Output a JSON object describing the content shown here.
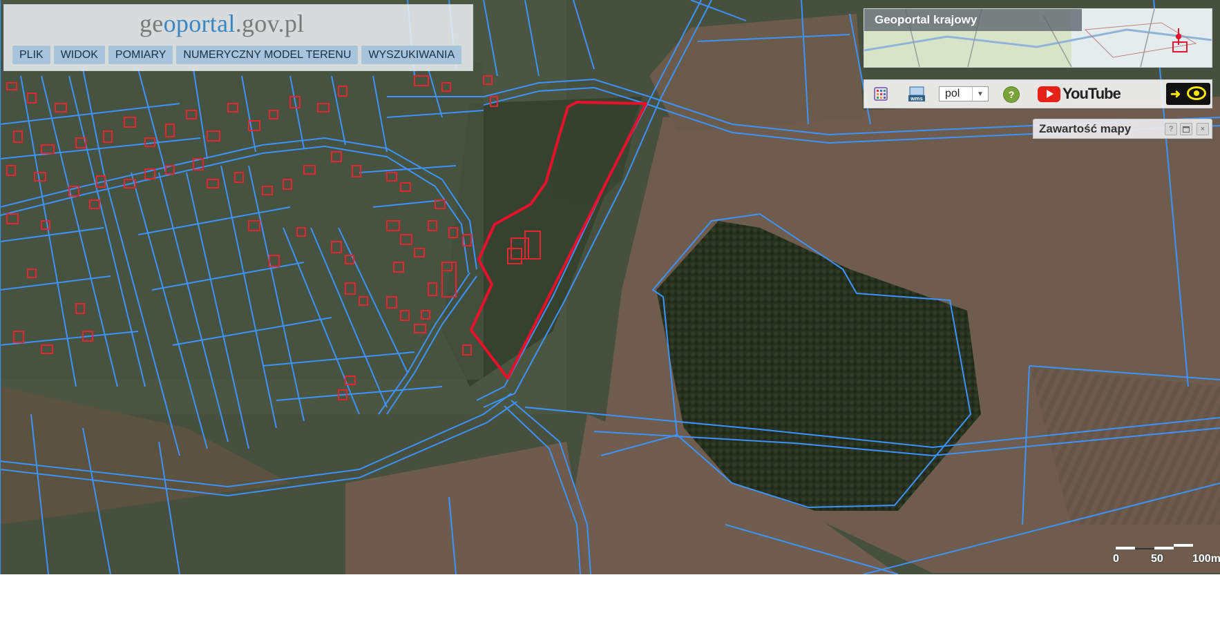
{
  "logo": {
    "part1": "ge",
    "part2": "o",
    "part3": "portal",
    "part4": ".gov.pl"
  },
  "menu": [
    {
      "label": "PLIK"
    },
    {
      "label": "WIDOK"
    },
    {
      "label": "POMIARY"
    },
    {
      "label": "NUMERYCZNY MODEL TERENU"
    },
    {
      "label": "WYSZUKIWANIA"
    }
  ],
  "minimap": {
    "title": "Geoportal krajowy"
  },
  "toolbar": {
    "language_value": "pol",
    "help_label": "?",
    "youtube_label": "YouTube",
    "icons": [
      "layers-icon",
      "wms-icon",
      "help-icon",
      "youtube-icon",
      "accessibility-icon"
    ]
  },
  "content_panel": {
    "title": "Zawartość mapy",
    "help": "?",
    "close": "×"
  },
  "scale": {
    "labels": [
      "0",
      "50",
      "100m"
    ]
  },
  "colors": {
    "parcel_lines": "#3d93ff",
    "buildings": "#e8242f",
    "highlight": "#e8102a"
  }
}
